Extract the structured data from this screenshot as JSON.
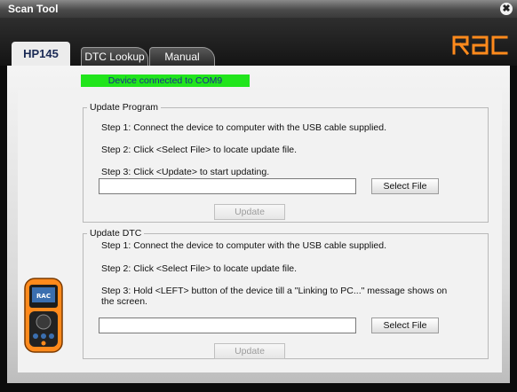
{
  "window": {
    "title": "Scan Tool",
    "close_glyph": "✖"
  },
  "brand": {
    "logo_text": "RAC"
  },
  "tabs": [
    {
      "label": "HP145",
      "active": true
    },
    {
      "label": "DTC Lookup"
    },
    {
      "label": "Manual"
    }
  ],
  "status": {
    "text": "Device connected to COM9",
    "color": "#21e51c"
  },
  "update_program": {
    "legend": "Update Program",
    "step1": "Step 1: Connect the device to computer with the USB cable supplied.",
    "step2": "Step 2: Click <Select File> to locate update file.",
    "step3": "Step 3: Click <Update> to start updating.",
    "file_path": "",
    "select_file_label": "Select File",
    "update_label": "Update"
  },
  "update_dtc": {
    "legend": "Update DTC",
    "step1": "Step 1: Connect the device to computer with the USB cable supplied.",
    "step2": "Step 2: Click <Select File> to locate update file.",
    "step3_line1": "Step 3: Hold <LEFT> button of the device till a \"Linking to PC...\" message shows on",
    "step3_line2": "the screen.",
    "file_path": "",
    "select_file_label": "Select File",
    "update_label": "Update"
  },
  "device_image": {
    "icon": "obd-scanner-device-icon",
    "screen_text": "RAC"
  },
  "colors": {
    "accent_orange": "#ff8a1c",
    "tab_active_text": "#1a2a55"
  }
}
